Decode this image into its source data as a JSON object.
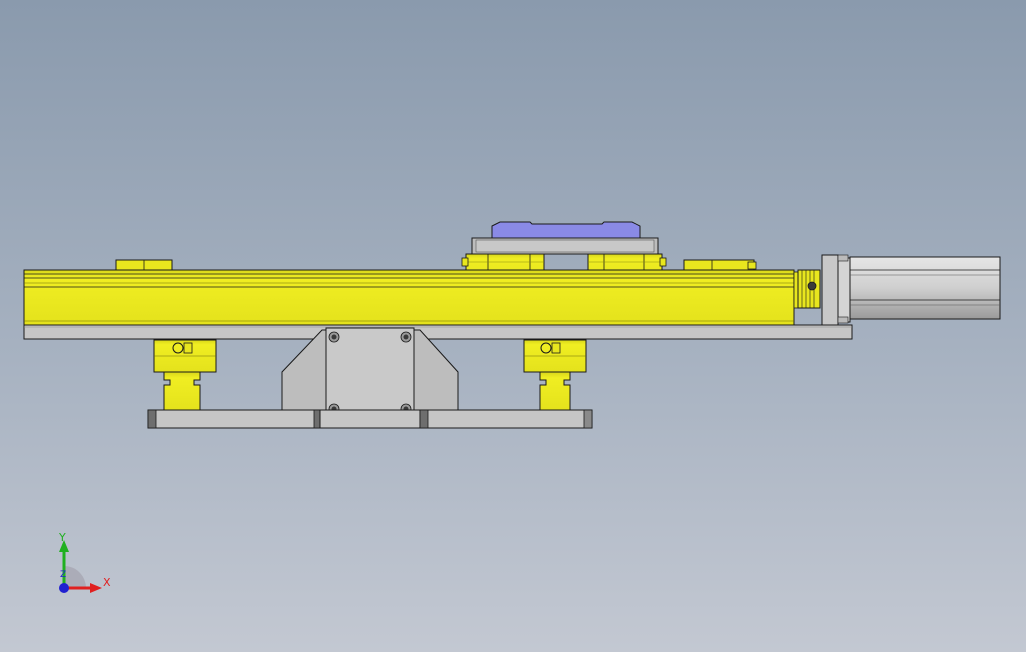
{
  "viewport": {
    "background_top": "#8a9aad",
    "background_bottom": "#c3c8d2"
  },
  "colors": {
    "rail_yellow": "#e8e61e",
    "rail_yellow_dark": "#b4b214",
    "base_grey": "#c4c4c4",
    "carriage_blue": "#8585e0",
    "outline": "#1a1a1a"
  },
  "triad": {
    "x_label": "X",
    "y_label": "Y",
    "z_label": "Z",
    "x_color": "#e02020",
    "y_color": "#20b020",
    "z_color": "#2020d0"
  }
}
